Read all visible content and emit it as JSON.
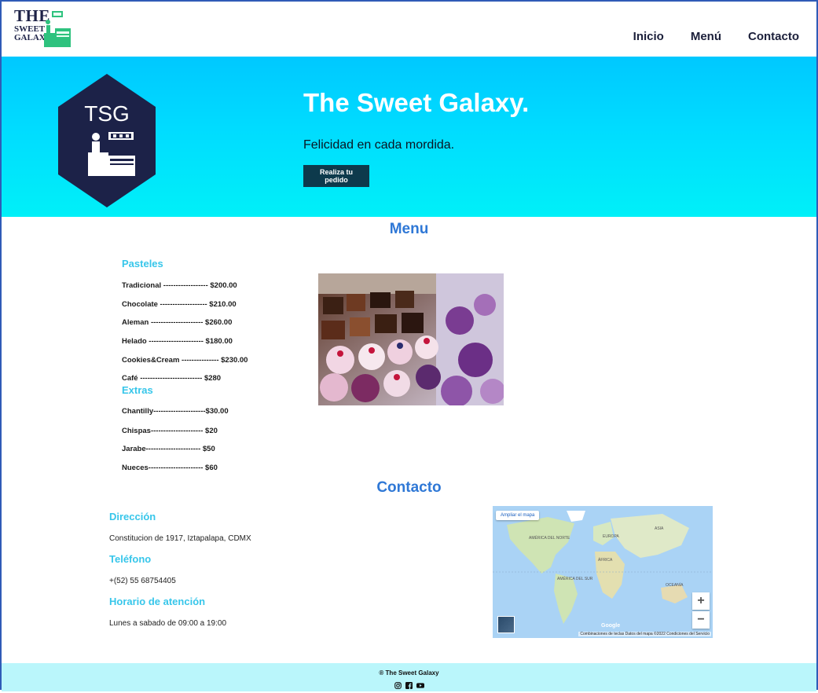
{
  "header": {
    "logo": {
      "line1": "THE",
      "line2": "SWEET",
      "line3": "GALAXY"
    },
    "nav": [
      {
        "label": "Inicio"
      },
      {
        "label": "Menú"
      },
      {
        "label": "Contacto"
      }
    ]
  },
  "hero": {
    "badge_text": "TSG",
    "title": "The Sweet Galaxy.",
    "subtitle": "Felicidad en cada mordida.",
    "button_label": "Realiza tu pedido"
  },
  "menu": {
    "title": "Menu",
    "pasteles": {
      "title": "Pasteles",
      "items": [
        "Tradicional ------------------ $200.00",
        "Chocolate ------------------- $210.00",
        "Aleman --------------------- $260.00",
        "Helado ---------------------- $180.00",
        "Cookies&Cream --------------- $230.00",
        "Café ------------------------- $280"
      ]
    },
    "extras": {
      "title": "Extras",
      "items": [
        "Chantilly---------------------$30.00",
        "Chispas--------------------- $20",
        "Jarabe---------------------- $50",
        "Nueces---------------------- $60"
      ]
    }
  },
  "contact": {
    "title": "Contacto",
    "address_title": "Dirección",
    "address": "Constitucion de 1917, Iztapalapa, CDMX",
    "phone_title": "Teléfono",
    "phone": "+(52) 55 68754405",
    "hours_title": "Horario de atención",
    "hours": "Lunes a sabado de 09:00 a 19:00"
  },
  "map": {
    "expand_label": "Ampliar el mapa",
    "zoom_in": "+",
    "zoom_out": "−",
    "provider": "Google",
    "footer": "Combinaciones de teclas   Datos del mapa ©2022   Condiciones del Servicio",
    "labels": {
      "na": "AMÉRICA DEL NORTE",
      "europe": "EUROPA",
      "asia": "ASIA",
      "africa": "ÁFRICA",
      "sa": "AMÉRICA DEL SUR",
      "oceania": "OCEANÍA"
    }
  },
  "footer": {
    "copyright": "® The Sweet Galaxy"
  }
}
